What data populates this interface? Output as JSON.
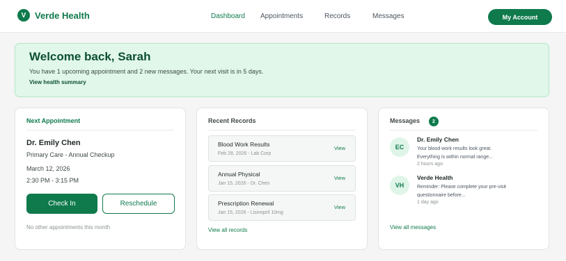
{
  "nav": {
    "brand_initial": "V",
    "brand_name": "Verde Health",
    "links": [
      "Dashboard",
      "Appointments",
      "Records",
      "Messages"
    ],
    "active_link": "Dashboard",
    "account_label": "My Account"
  },
  "welcome": {
    "title": "Welcome back, Sarah",
    "text": "You have 1 upcoming appointment and 2 new messages. Your next visit is in 5 days.",
    "link": "View health summary"
  },
  "appointment": {
    "title": "Next Appointment",
    "doctor": "Dr. Emily Chen",
    "type": "Primary Care - Annual Checkup",
    "date": "March 12, 2026",
    "time": "2:30 PM - 3:15 PM",
    "checkin_label": "Check In",
    "reschedule_label": "Reschedule",
    "note": "No other appointments this month"
  },
  "records": {
    "title": "Recent Records",
    "items": [
      {
        "title": "Blood Work Results",
        "meta": "Feb 28, 2026 - Lab Corp",
        "action": "View"
      },
      {
        "title": "Annual Physical",
        "meta": "Jan 15, 2026 - Dr. Chen",
        "action": "View"
      },
      {
        "title": "Prescription Renewal",
        "meta": "Jan 15, 2026 - Lisinopril 10mg",
        "action": "View"
      }
    ],
    "link": "View all records"
  },
  "messages": {
    "title": "Messages",
    "count": "2",
    "items": [
      {
        "initials": "EC",
        "from": "Dr. Emily Chen",
        "body": "Your blood work results look great. Everything is within normal range...",
        "time": "2 hours ago"
      },
      {
        "initials": "VH",
        "from": "Verde Health",
        "body": "Reminder: Please complete your pre-visit questionnaire before...",
        "time": "1 day ago"
      }
    ],
    "link": "View all messages"
  },
  "colors": {
    "brand": "#0f7a4c",
    "banner_bg": "#e1f7ea",
    "heading": "#0d4f32"
  }
}
